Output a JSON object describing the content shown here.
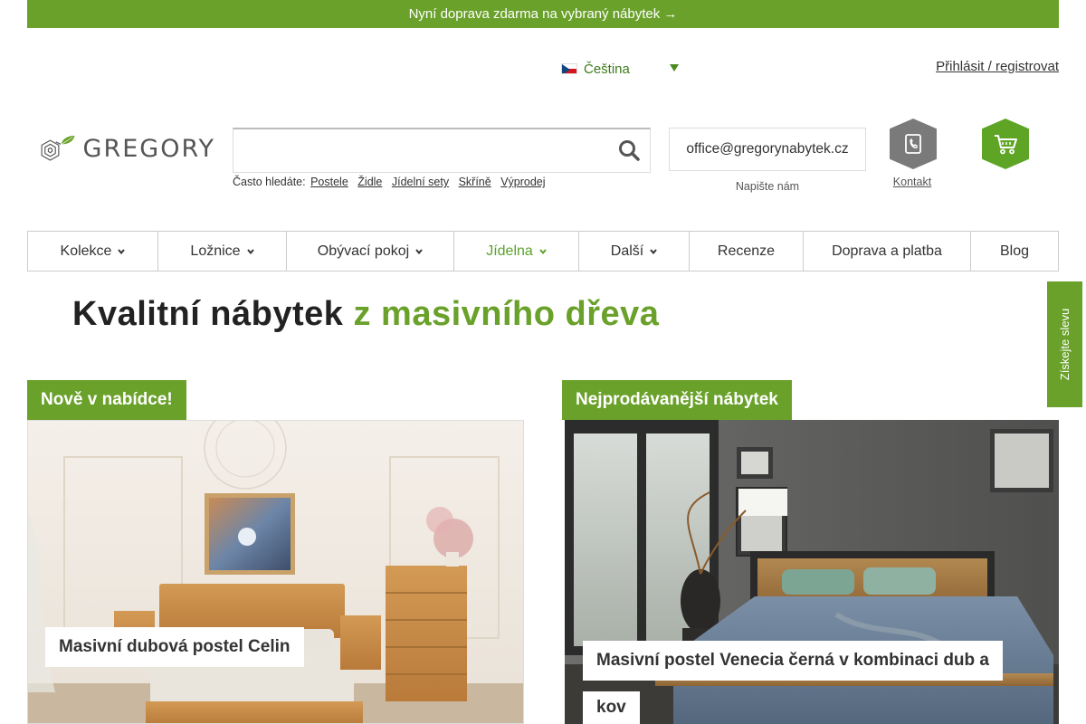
{
  "promo": {
    "text": "Nyní doprava zdarma na vybraný nábytek →"
  },
  "language": {
    "selected": "Čeština"
  },
  "account": {
    "login_label": "Přihlásit / registrovat"
  },
  "logo": {
    "text": "GREGORY"
  },
  "search": {
    "value": "",
    "placeholder": ""
  },
  "often_searched": {
    "label": "Často hledáte:",
    "links": [
      "Postele",
      "Židle",
      "Jídelní sety",
      "Skříně",
      "Výprodej"
    ]
  },
  "contact": {
    "email": "office@gregorynabytek.cz",
    "email_sub": "Napište nám",
    "contact_label": "Kontakt"
  },
  "nav": {
    "items": [
      {
        "label": "Kolekce",
        "dropdown": true
      },
      {
        "label": "Ložnice",
        "dropdown": true
      },
      {
        "label": "Obývací pokoj",
        "dropdown": true
      },
      {
        "label": "Jídelna",
        "dropdown": true,
        "active": true
      },
      {
        "label": "Další",
        "dropdown": true
      },
      {
        "label": "Recenze",
        "dropdown": false
      },
      {
        "label": "Doprava a platba",
        "dropdown": false
      },
      {
        "label": "Blog",
        "dropdown": false
      }
    ]
  },
  "headline": {
    "part1": "Kvalitní nábytek ",
    "part2": "z masivního dřeva"
  },
  "sections": {
    "left": {
      "tag": "Nově v nabídce!",
      "caption": "Masivní dubová postel Celin"
    },
    "right": {
      "tag": "Nejprodávanější nábytek",
      "caption_line1": "Masivní postel Venecia černá v kombinaci dub a",
      "caption_line2": "kov"
    }
  },
  "side_tab": {
    "label": "Získejte slevu"
  },
  "colors": {
    "accent": "#6aa12a",
    "accent_text": "#3d7b1a"
  }
}
